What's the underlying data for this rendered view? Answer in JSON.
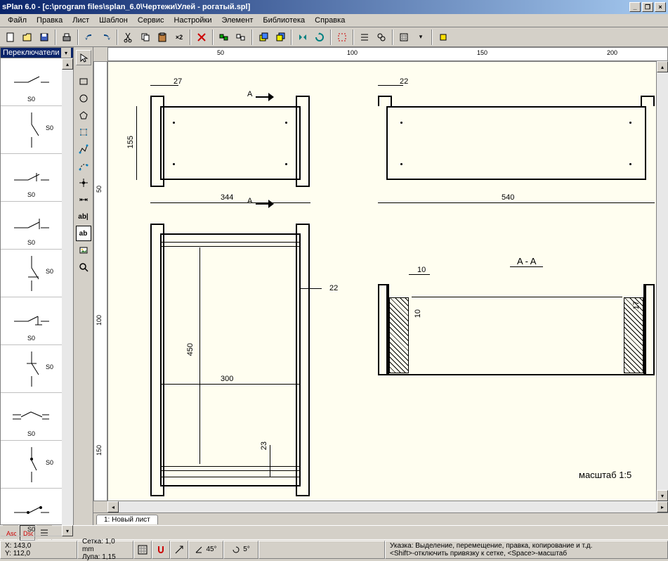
{
  "titlebar": {
    "title": "sPlan 6.0 - [c:\\program files\\splan_6.0\\Чертежи\\Улей - рогатый.spl]"
  },
  "menu": {
    "items": [
      "Файл",
      "Правка",
      "Лист",
      "Шаблон",
      "Сервис",
      "Настройки",
      "Элемент",
      "Библиотека",
      "Справка"
    ]
  },
  "library": {
    "dropdown": "Переключатели",
    "item_label": "S0"
  },
  "ruler": {
    "h": [
      "50",
      "100",
      "150",
      "200"
    ],
    "v": [
      "50",
      "100",
      "150"
    ]
  },
  "tabs": {
    "sheet1": "1: Новый лист"
  },
  "status": {
    "x_label": "X:",
    "x_val": "143,0",
    "y_label": "Y:",
    "y_val": "112,0",
    "grid": "Сетка: 1,0 mm",
    "zoom": "Лупа:  1,15",
    "angle": "45°",
    "step": "5°",
    "hint": "Указка: Выделение, перемещение, правка, копирование и т.д.",
    "hint2": "<Shift>-отключить привязку к сетке, <Space>-масштаб"
  },
  "drawing": {
    "d27": "27",
    "d22": "22",
    "d22b": "22",
    "d155": "155",
    "d344": "344",
    "d540": "540",
    "d450": "450",
    "d300": "300",
    "d23": "23",
    "d10": "10",
    "d10b": "10",
    "d17": "17",
    "secA": "A",
    "secAA": "A - A",
    "scale": "масштаб  1:5"
  },
  "toolbar": {
    "x2": "×2"
  },
  "drawtools": {
    "ab1": "ab|",
    "ab2": "ab"
  }
}
